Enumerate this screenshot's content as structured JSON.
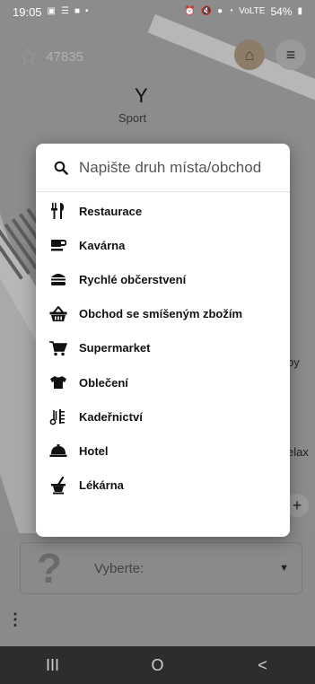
{
  "status_bar": {
    "time": "19:05",
    "battery": "54%",
    "signal_text": "VoLTE"
  },
  "map": {
    "score": "47835",
    "poi_label": "Sport",
    "side_texts": [
      "by",
      "elax"
    ]
  },
  "dialog": {
    "search_placeholder": "Napište druh místa/obchod",
    "items": [
      {
        "label": "Restaurace",
        "icon": "fork-knife-icon"
      },
      {
        "label": "Kavárna",
        "icon": "coffee-cup-icon"
      },
      {
        "label": "Rychlé občerstvení",
        "icon": "burger-icon"
      },
      {
        "label": "Obchod se smíšeným zbožím",
        "icon": "shopping-basket-icon"
      },
      {
        "label": "Supermarket",
        "icon": "shopping-cart-icon"
      },
      {
        "label": "Oblečení",
        "icon": "tshirt-icon"
      },
      {
        "label": "Kadeřnictví",
        "icon": "scissors-icon"
      },
      {
        "label": "Hotel",
        "icon": "bell-icon"
      },
      {
        "label": "Lékárna",
        "icon": "mortar-pestle-icon"
      }
    ]
  },
  "bottom_panel": {
    "select_label": "Vyberte:",
    "question_mark": "?"
  },
  "navbar": {
    "recent": "III",
    "home": "O",
    "back": "<"
  },
  "colors": {
    "dim_overlay": "#6f6f6f",
    "dialog_bg": "#ffffff",
    "text_dark": "#111111"
  }
}
